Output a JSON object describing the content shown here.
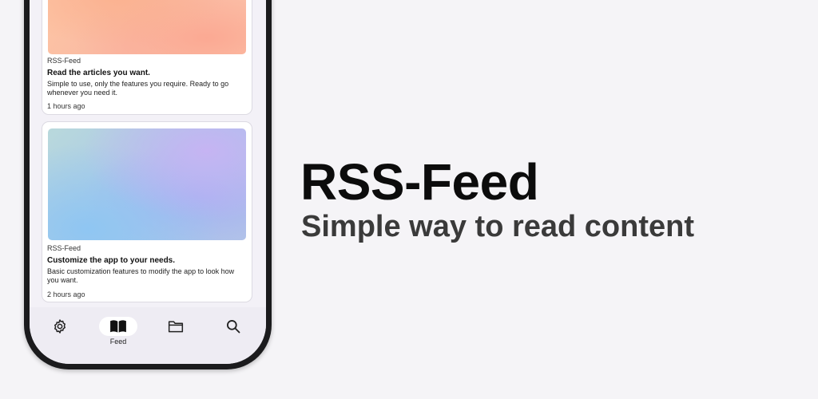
{
  "feed": {
    "articles": [
      {
        "source": "RSS-Feed",
        "title": "Read the articles you want.",
        "description": "Simple to use, only the features you require. Ready to go whenever you need it.",
        "time": "1 hours ago",
        "thumbnail": "peach-gradient"
      },
      {
        "source": "RSS-Feed",
        "title": "Customize the app to your needs.",
        "description": "Basic customization features to modify the app to look how you want.",
        "time": "2 hours ago",
        "thumbnail": "blue-purple-gradient"
      }
    ]
  },
  "nav": {
    "items": [
      {
        "icon": "gear-icon",
        "label": ""
      },
      {
        "icon": "book-icon",
        "label": "Feed",
        "active": true
      },
      {
        "icon": "folder-icon",
        "label": ""
      },
      {
        "icon": "search-icon",
        "label": ""
      }
    ]
  },
  "promo": {
    "headline": "RSS-Feed",
    "subline": "Simple way to read content"
  },
  "colors": {
    "background": "#f5f4f7",
    "phone_frame": "#1b1b1d",
    "nav_active_pill": "#ffffff"
  }
}
